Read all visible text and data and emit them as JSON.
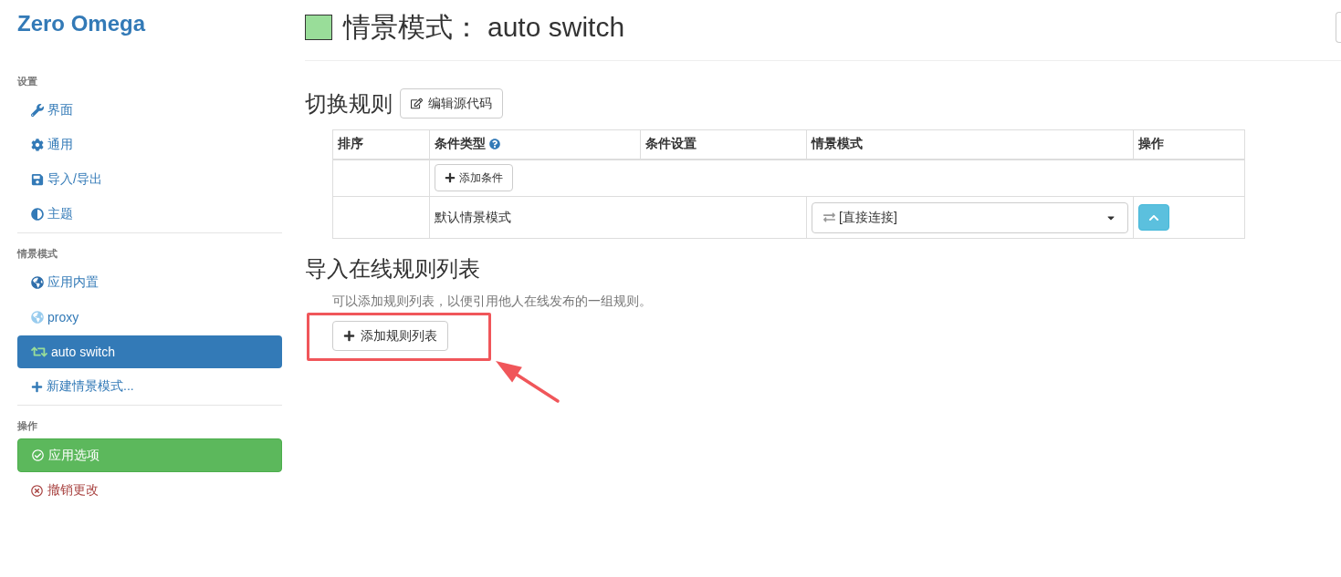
{
  "sidebar": {
    "title": "Zero Omega",
    "sections": [
      {
        "heading": "设置",
        "items": [
          {
            "kind": "link",
            "label": "界面",
            "selected": false
          },
          {
            "kind": "link",
            "label": "通用",
            "selected": false
          },
          {
            "kind": "link",
            "label": "导入/导出",
            "selected": false
          },
          {
            "kind": "link",
            "label": "主题",
            "selected": false
          }
        ]
      },
      {
        "heading": "情景模式",
        "items": [
          {
            "kind": "proxy",
            "label": "应用内置",
            "color": "#2f6fab",
            "selected": false
          },
          {
            "kind": "proxy",
            "label": "proxy",
            "color": "#99ccee",
            "selected": false
          },
          {
            "kind": "switch",
            "label": "auto switch",
            "color": "#99dd99",
            "selected": true
          },
          {
            "kind": "new",
            "label": "新建情景模式...",
            "selected": false
          }
        ]
      },
      {
        "heading": "操作",
        "items": [
          {
            "kind": "apply",
            "label": "应用选项"
          },
          {
            "kind": "discard",
            "label": "撤销更改"
          }
        ]
      }
    ]
  },
  "page_header": {
    "color": "#99dd99",
    "label": "情景模式：",
    "name": "auto switch"
  },
  "switch_rules": {
    "heading": "切换规则",
    "edit_button": "编辑源代码",
    "columns": [
      {
        "label": "排序",
        "help": false
      },
      {
        "label": "条件类型",
        "help": true
      },
      {
        "label": "条件设置",
        "help": false
      },
      {
        "label": "情景模式",
        "help": false
      },
      {
        "label": "操作",
        "help": false
      }
    ],
    "add_condition_button": "添加条件",
    "default_row": {
      "label": "默认情景模式",
      "profile": "[直接连接]"
    }
  },
  "online_rules": {
    "heading": "导入在线规则列表",
    "description": "可以添加规则列表，以便引用他人在线发布的一组规则。",
    "add_button": "添加规则列表"
  }
}
